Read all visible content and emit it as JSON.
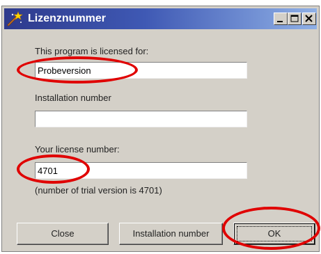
{
  "window": {
    "title": "Lizenznummer",
    "icon": "magic-wand-icon",
    "controls": [
      "minimize-icon",
      "maximize-icon",
      "close-icon"
    ]
  },
  "form": {
    "licensed_for_label": "This program is licensed for:",
    "licensed_for_value": "Probeversion",
    "installation_number_label": "Installation number",
    "installation_number_value": "",
    "license_number_label": "Your license number:",
    "license_number_value": "4701",
    "trial_note": "(number of trial version is 4701)"
  },
  "buttons": {
    "close": "Close",
    "installation_number": "Installation number",
    "ok": "OK"
  },
  "colors": {
    "titlebar_start": "#2e3a8c",
    "titlebar_end": "#8fb0e6",
    "dialog_bg": "#d4d0c8",
    "highlight": "#e00000"
  }
}
